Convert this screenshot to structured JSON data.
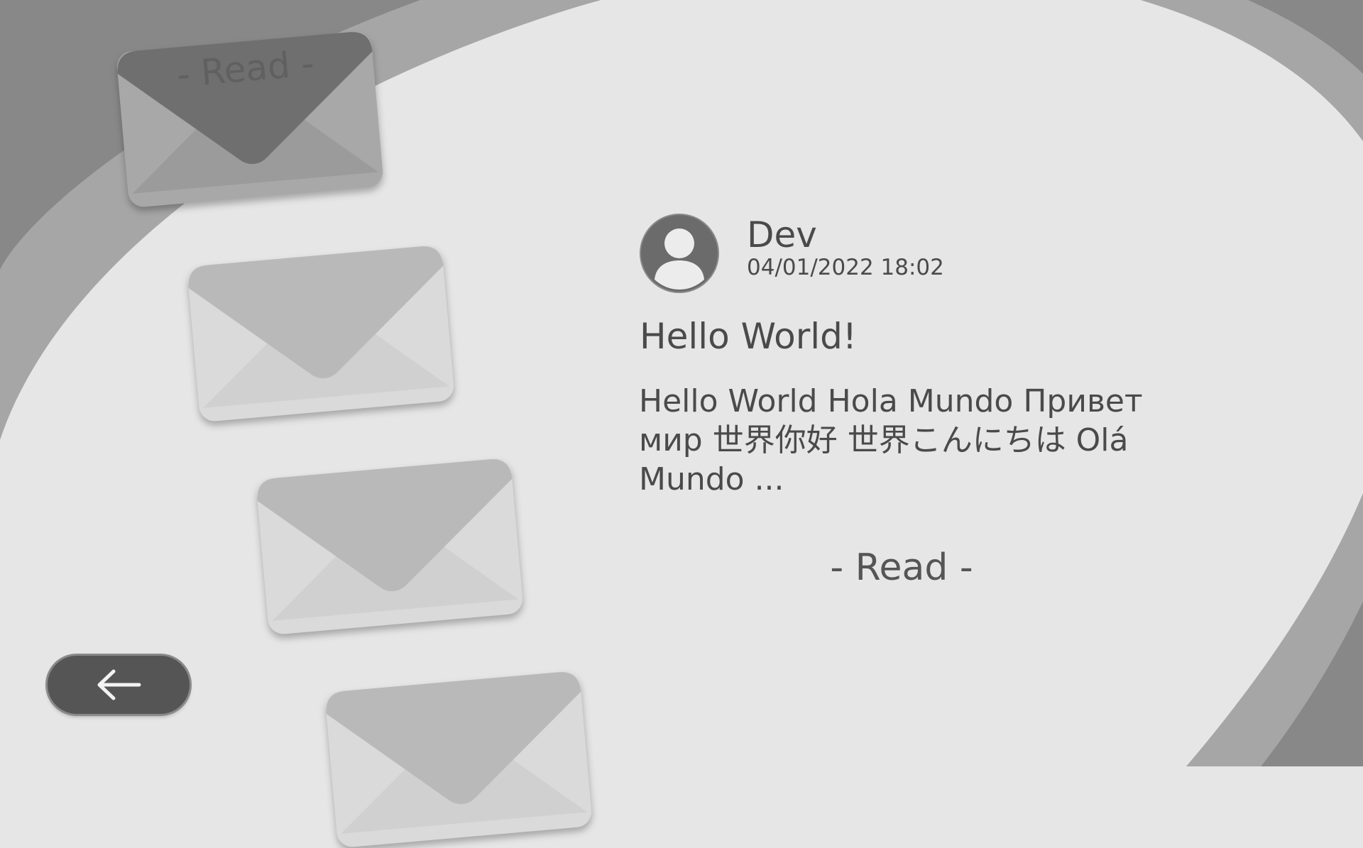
{
  "letters": [
    {
      "label": "- Read -",
      "state": "read",
      "color": "#6f6f6f"
    },
    {
      "label": "",
      "state": "unread",
      "color": "#b9b9b9"
    },
    {
      "label": "",
      "state": "unread",
      "color": "#b9b9b9"
    },
    {
      "label": "",
      "state": "unread",
      "color": "#b9b9b9"
    }
  ],
  "message": {
    "sender": "Dev",
    "date": "04/01/2022  18:02",
    "subject": "Hello World!",
    "body": "Hello World Hola Mundo Привет мир 世界你好  世界こんにちは  Olá Mundo ..."
  },
  "read_button": {
    "label": "- Read -"
  },
  "icons": {
    "avatar": "user-avatar-icon",
    "back": "arrow-left-icon"
  },
  "colors": {
    "background": "#e6e6e6",
    "band_dark": "#888888",
    "band_light": "#a6a6a6",
    "text": "#4a4a4a",
    "back_button": "#555555"
  }
}
